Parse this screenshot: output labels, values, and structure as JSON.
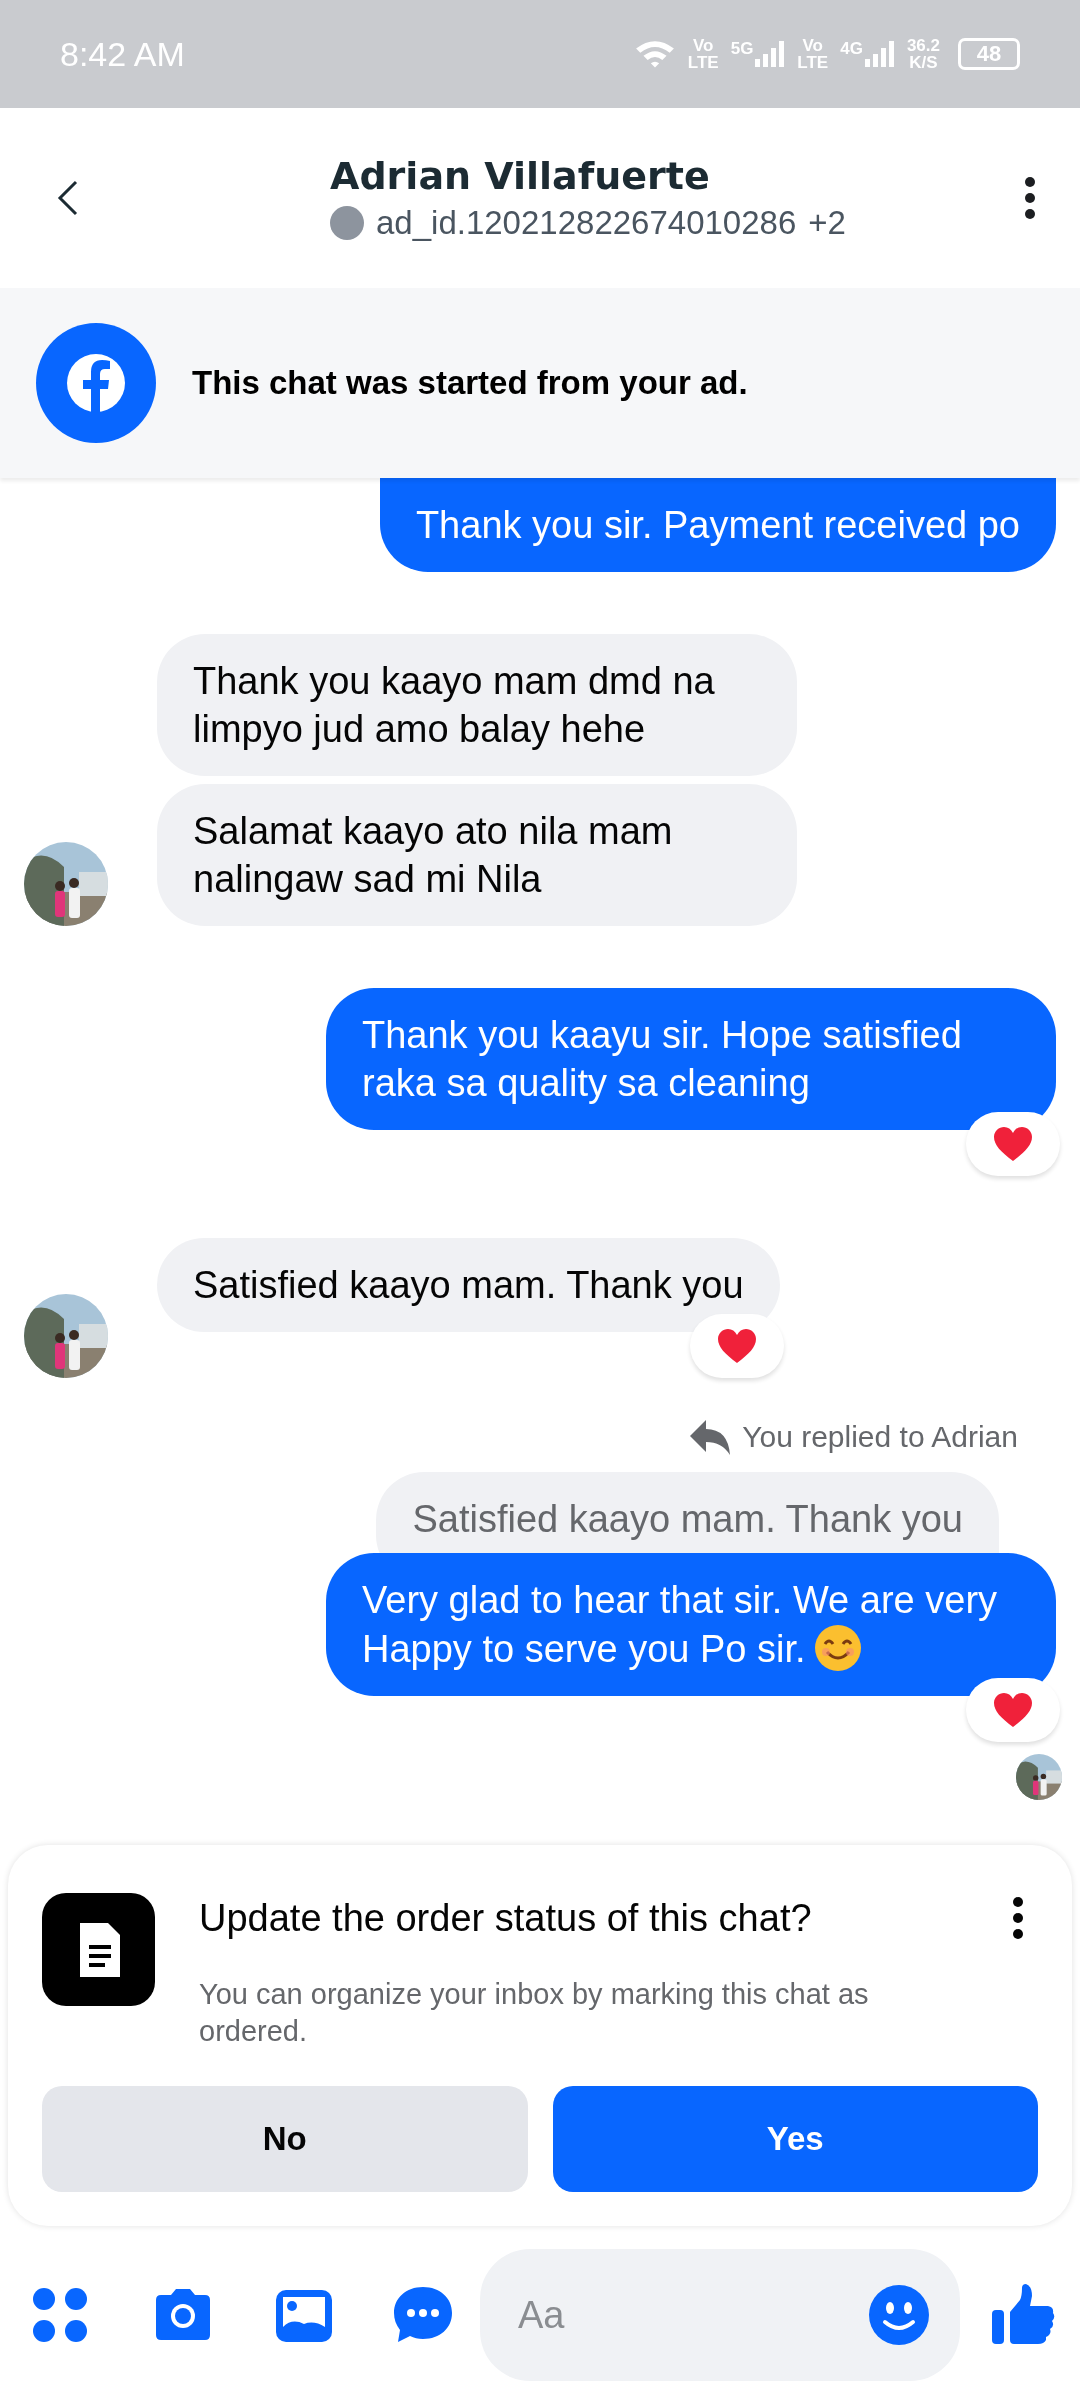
{
  "status_bar": {
    "time": "8:42 AM",
    "networks": [
      {
        "upper": "Vo",
        "lower": "LTE",
        "signal": "5G"
      },
      {
        "upper": "Vo",
        "lower": "LTE",
        "signal": "4G"
      }
    ],
    "speed": {
      "value": "36.2",
      "unit": "K/S"
    },
    "battery": "48"
  },
  "header": {
    "title": "Adrian Villafuerte",
    "subtitle": "ad_id.120212822674010286",
    "extra": "+2"
  },
  "ad_banner": {
    "text": "This chat was started from your ad."
  },
  "messages": [
    {
      "kind": "sent",
      "text": "Thank you sir. Payment received po",
      "reacted": false
    },
    {
      "kind": "received",
      "text": "Thank you kaayo mam dmd na limpyo jud amo balay hehe",
      "reacted": false,
      "avatar": false
    },
    {
      "kind": "received",
      "text": "Salamat kaayo ato nila mam nalingaw sad mi Nila",
      "reacted": false,
      "avatar": true
    },
    {
      "kind": "sent",
      "text": "Thank you kaayu sir. Hope satisfied raka sa quality sa cleaning",
      "reacted": true
    },
    {
      "kind": "received",
      "text": "Satisfied kaayo mam. Thank you",
      "reacted": true,
      "avatar": true
    },
    {
      "kind": "reply_note",
      "text": "You replied to Adrian"
    },
    {
      "kind": "quoted",
      "text": "Satisfied kaayo mam. Thank you"
    },
    {
      "kind": "sent",
      "text": "Very glad to hear that sir. We are very Happy to serve you Po sir.",
      "emoji": true,
      "reacted": true
    },
    {
      "kind": "seen"
    }
  ],
  "order_card": {
    "title": "Update the order status of this chat?",
    "description": "You can organize your inbox by marking this chat as ordered.",
    "buttons": [
      {
        "label": "No",
        "kind": "secondary"
      },
      {
        "label": "Yes",
        "kind": "primary"
      }
    ]
  },
  "composer": {
    "placeholder": "Aa"
  }
}
